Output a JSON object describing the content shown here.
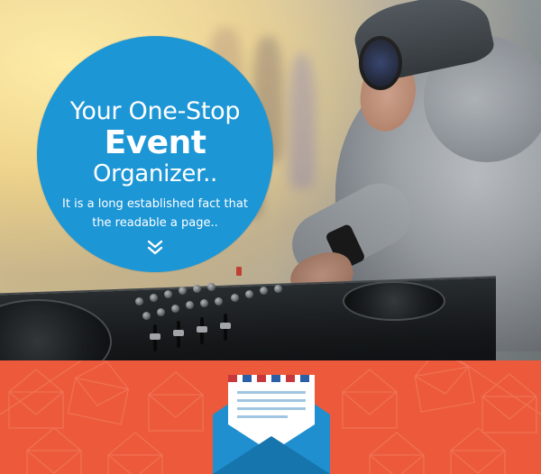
{
  "hero": {
    "headline_line1": "Your One-Stop",
    "headline_line2": "Event",
    "headline_line3": "Organizer..",
    "description": "It is a long established fact that the readable a page..",
    "scroll_icon": "double-chevron-down-icon"
  },
  "footer": {
    "icon": "envelope-letter-icon"
  },
  "colors": {
    "circle_blue": "#1d96d6",
    "footer_orange": "#ec5a3b",
    "envelope_blue": "#1f8fcf",
    "envelope_dark_blue": "#1775ad",
    "letter_stripe_red": "#c8383b",
    "letter_stripe_blue": "#2a5fa8"
  }
}
